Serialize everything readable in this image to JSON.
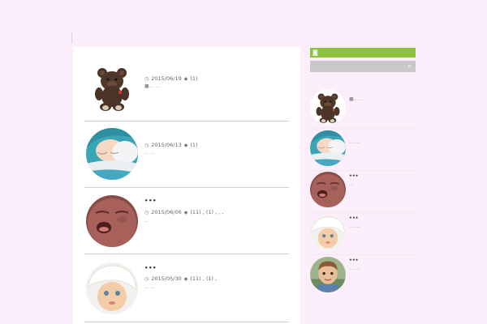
{
  "main": {
    "posts": [
      {
        "date": "2015/06/19",
        "tags": "(1)",
        "title": "",
        "excerpt": "■... ...",
        "image": "teddy-bear"
      },
      {
        "date": "2015/06/13",
        "tags": "(1)",
        "title": "",
        "excerpt": "... ...",
        "image": "sleeping-baby"
      },
      {
        "date": "2015/06/06",
        "tags": "(11) , (1) ,  , ,",
        "title": "•••",
        "excerpt": "...",
        "image": "crying-baby"
      },
      {
        "date": "2015/05/30",
        "tags": "(11) , (1) ,",
        "title": "•••",
        "excerpt": "... ...",
        "image": "baby-bonnet"
      }
    ]
  },
  "sidebar": {
    "search_placeholder": "",
    "items": [
      {
        "title": "",
        "text": "■... ...",
        "image": "teddy-bear"
      },
      {
        "title": "",
        "text": "... ...",
        "image": "sleeping-baby"
      },
      {
        "title": "•••",
        "text": "...",
        "image": "crying-baby"
      },
      {
        "title": "•••",
        "text": "... ...",
        "image": "baby-bonnet"
      },
      {
        "title": "•••",
        "text": "... ...",
        "image": "toddler"
      }
    ]
  },
  "icons": {
    "clock": "clock-icon",
    "tag": "tag-icon",
    "rss": "rss-icon",
    "search": "search-icon"
  },
  "colors": {
    "background": "#fdeefb",
    "rss_bar": "#8cc43d",
    "search_bar": "#c8c8c8",
    "divider": "#cfcfcf"
  }
}
